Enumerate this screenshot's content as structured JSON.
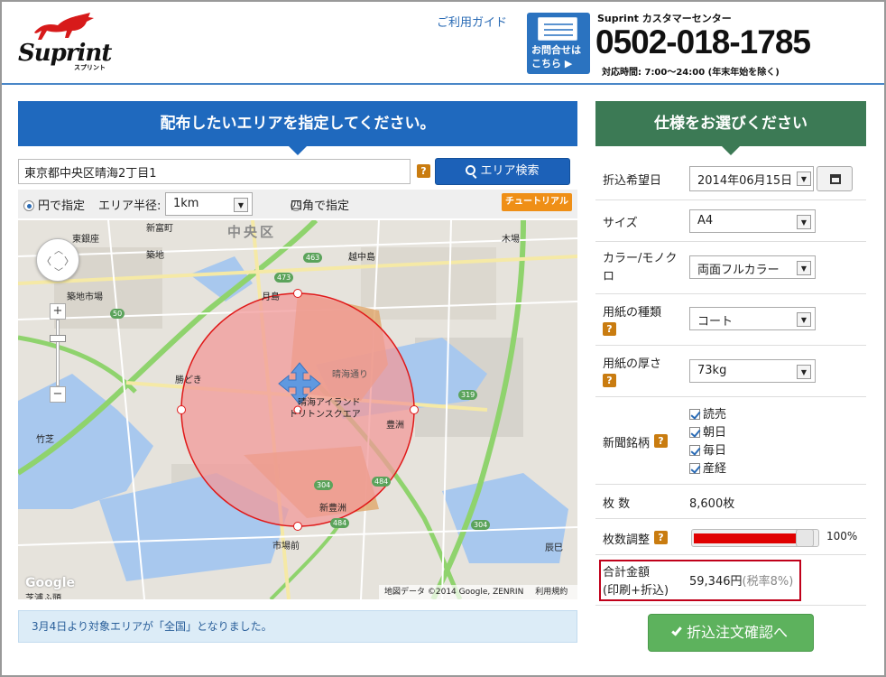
{
  "header": {
    "logo_text": "Suprint",
    "logo_sub": "スプリント",
    "guide_link": "ご利用ガイド",
    "contact_button": [
      "お問合せは",
      "こちら ▶"
    ],
    "center_title": "Suprint カスタマーセンター",
    "phone": "0502-018-1785",
    "hours": "対応時間: 7:00〜24:00 (年末年始を除く)"
  },
  "left_panel": {
    "banner": "配布したいエリアを指定してください。",
    "address_value": "東京都中央区晴海2丁目1",
    "help_icon": "?",
    "search_button": "エリア検索",
    "circle_option": "円で指定",
    "radius_label": "エリア半径:",
    "radius_value": "1km",
    "square_option": "四角で指定",
    "tutorial_button": "チュートリアル",
    "map": {
      "labels": {
        "chuo_ku": "中央区",
        "higashi_ginza": "東銀座",
        "shintomicho": "新富町",
        "tsukiji": "築地",
        "tsukiji_market": "築地市場",
        "kachidoki": "勝どき",
        "tsukishima": "月島",
        "etchujima": "越中島",
        "kiba": "木場",
        "harumi_dori": "晴海通り",
        "harumi_island": "晴海アイランド",
        "triton_square": "トリトンスクエア",
        "toyosu": "豊洲",
        "shin_toyosu": "新豊洲",
        "shijomae": "市場前",
        "takeshiba": "竹芝",
        "shibaura_futo": "芝浦ふ頭",
        "tatsumi": "辰巳",
        "google": "Google",
        "copyright": "地図データ ©2014 Google, ZENRIN",
        "terms": "利用規約"
      },
      "route_numbers": {
        "r473": "473",
        "r463": "463",
        "r50": "50",
        "r319": "319",
        "r304a": "304",
        "r484a": "484",
        "r484b": "484",
        "r304b": "304"
      },
      "zoom_in": "+",
      "zoom_out": "−",
      "zoom_level_fraction": 0.55
    },
    "notice": "3月4日より対象エリアが「全国」となりました。"
  },
  "right_panel": {
    "banner": "仕様をお選びください",
    "rows": {
      "date_label": "折込希望日",
      "date_value": "2014年06月15日",
      "size_label": "サイズ",
      "size_value": "A4",
      "color_label": "カラー/モノクロ",
      "color_value": "両面フルカラー",
      "paper_type_label": "用紙の種類",
      "paper_type_value": "コート",
      "thickness_label": "用紙の厚さ",
      "thickness_value": "73kg",
      "newspaper_label": "新聞銘柄",
      "newspapers": [
        "読売",
        "朝日",
        "毎日",
        "産経"
      ],
      "count_label": "枚 数",
      "count_value": "8,600枚",
      "adjust_label": "枚数調整",
      "adjust_value": "100%",
      "adjust_fraction": 0.85,
      "total_label_1": "合計金額",
      "total_label_2": "(印刷+折込)",
      "total_value": "59,346円",
      "total_tax": "(税率8%)"
    },
    "confirm_button": "折込注文確認へ"
  },
  "colors": {
    "blue_banner": "#1f69be",
    "green_banner": "#3c7a55",
    "confirm_green": "#5db25d",
    "help_orange": "#c97c10",
    "slider_red": "#e00000",
    "total_border": "#c0001a"
  }
}
